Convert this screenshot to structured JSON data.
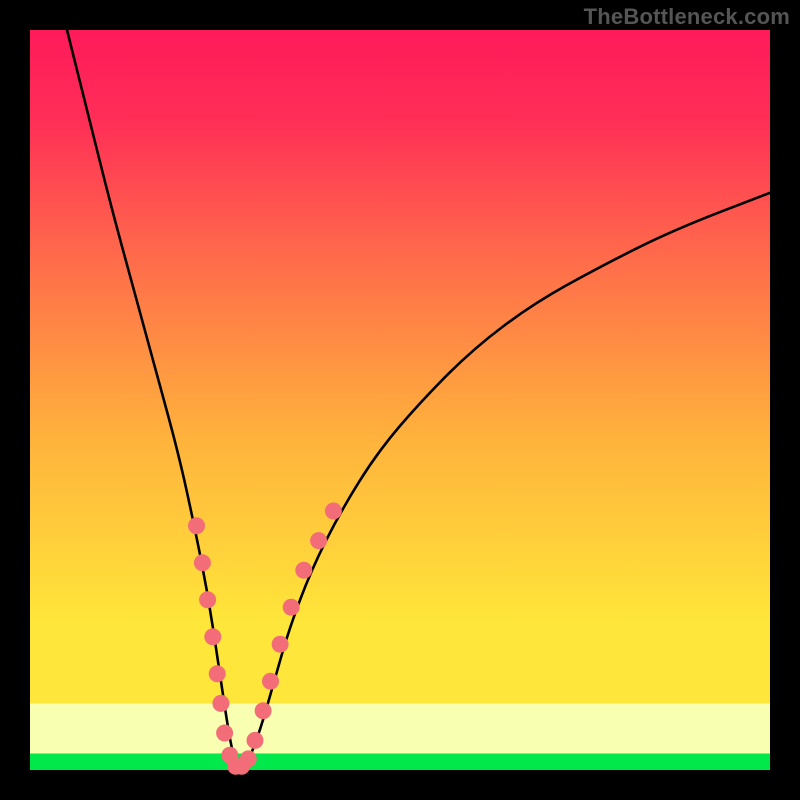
{
  "watermark": "TheBottleneck.com",
  "chart_data": {
    "type": "line",
    "title": "",
    "xlabel": "",
    "ylabel": "",
    "xlim": [
      0,
      100
    ],
    "ylim": [
      0,
      100
    ],
    "grid": false,
    "series": [
      {
        "name": "curve",
        "x": [
          5,
          8,
          11,
          14,
          17,
          20,
          22,
          24,
          25.5,
          27,
          28,
          29,
          31,
          33,
          35,
          38,
          42,
          47,
          53,
          60,
          68,
          77,
          87,
          100
        ],
        "values": [
          100,
          88,
          76,
          65,
          54,
          43,
          34,
          24,
          14,
          4,
          0,
          0,
          5,
          12,
          19,
          27,
          35,
          43,
          50,
          57,
          63,
          68,
          73,
          78
        ]
      }
    ],
    "markers": [
      {
        "x": 22.5,
        "y": 33
      },
      {
        "x": 23.3,
        "y": 28
      },
      {
        "x": 24.0,
        "y": 23
      },
      {
        "x": 24.7,
        "y": 18
      },
      {
        "x": 25.3,
        "y": 13
      },
      {
        "x": 25.8,
        "y": 9
      },
      {
        "x": 26.3,
        "y": 5
      },
      {
        "x": 27.0,
        "y": 2
      },
      {
        "x": 27.8,
        "y": 0.5
      },
      {
        "x": 28.6,
        "y": 0.5
      },
      {
        "x": 29.5,
        "y": 1.5
      },
      {
        "x": 30.4,
        "y": 4
      },
      {
        "x": 31.5,
        "y": 8
      },
      {
        "x": 32.5,
        "y": 12
      },
      {
        "x": 33.8,
        "y": 17
      },
      {
        "x": 35.3,
        "y": 22
      },
      {
        "x": 37.0,
        "y": 27
      },
      {
        "x": 39.0,
        "y": 31
      },
      {
        "x": 41.0,
        "y": 35
      }
    ],
    "colors": {
      "curve": "#000000",
      "markers": "#f26d78",
      "gradient_top": "#ff1a5a",
      "gradient_mid": "#ffb23c",
      "gradient_low": "#ffe63a",
      "pale_band": "#f8ffb0",
      "green_band": "#00e84a"
    }
  }
}
